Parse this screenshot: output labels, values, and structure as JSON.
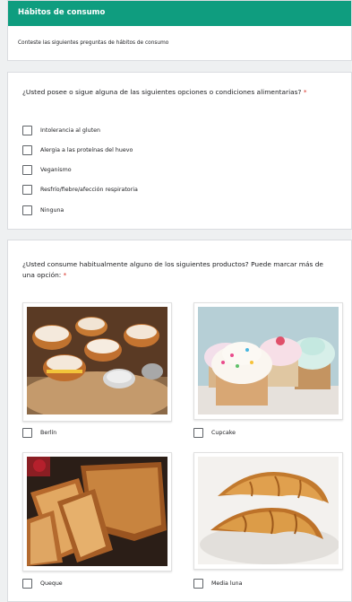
{
  "section": {
    "title": "Hábitos de consumo",
    "description": "Conteste las siguientes preguntas de hábitos de consumo"
  },
  "question1": {
    "title": "¿Usted posee o sigue alguna de las siguientes opciones o condiciones alimentarias?",
    "required_mark": "*",
    "options": [
      "Intolerancia al gluten",
      "Alergia a las proteínas del huevo",
      "Veganismo",
      "Resfrío/fiebre/afección respiratoria",
      "Ninguna"
    ]
  },
  "question2": {
    "title": "¿Usted consume habitualmente alguno de los siguientes productos? Puede marcar más de una opción:",
    "required_mark": "*",
    "options": [
      {
        "label": "Berlín",
        "image": "berlin-pastry-image"
      },
      {
        "label": "Cupcake",
        "image": "cupcake-image"
      },
      {
        "label": "Queque",
        "image": "pound-cake-image"
      },
      {
        "label": "Media luna",
        "image": "croissant-image"
      }
    ]
  },
  "colors": {
    "accent": "#0f9d7f",
    "required": "#d93025",
    "background": "#eef0f1"
  }
}
